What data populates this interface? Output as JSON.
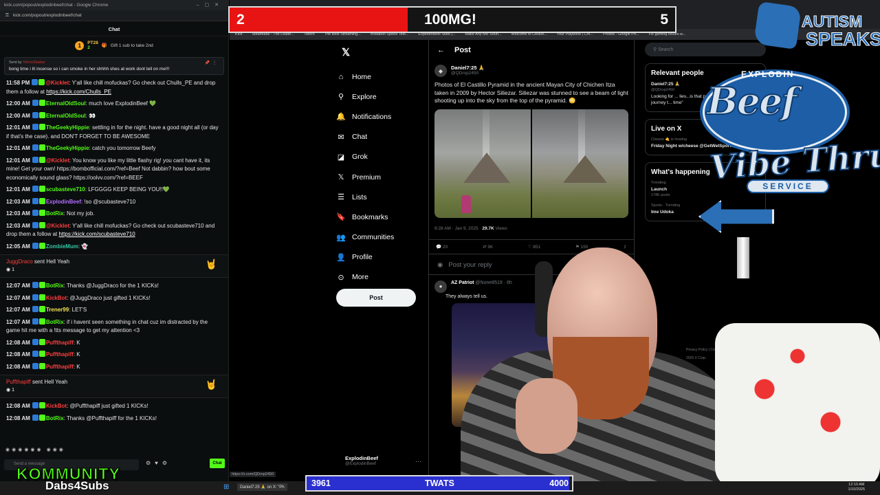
{
  "chat_window": {
    "title": "kick.com/popout/explodinbeef/chat - Google Chrome",
    "url": "kick.com/popout/explodinbeef/chat",
    "header": "Chat",
    "gift_bar": {
      "rank": "1",
      "user": "PT28",
      "count": "2",
      "label": "Gift 1 sub to take 2nd"
    },
    "pinned": {
      "sent_by": "Sent by",
      "pinner": "TehnoSkabar",
      "message": "bong time i lit incense so i can smoke in her shhhh shes at work dont tell on me!!!"
    },
    "messages": [
      {
        "ts": "11:58 PM",
        "user": "@Kicklet",
        "cls": "u-red",
        "text": ": Y'all like chill mofuckas? Go check out Chulls_PE and drop them a follow at ",
        "link": "https://kick.com/Chulls_PE"
      },
      {
        "ts": "12:00 AM",
        "user": "EternalOldSoul",
        "cls": "u-green",
        "text": ": much love ExplodinBeef 💚",
        "link": ""
      },
      {
        "ts": "12:00 AM",
        "user": "EternalOldSoul",
        "cls": "u-green",
        "text": ": 👀",
        "link": ""
      },
      {
        "ts": "12:01 AM",
        "user": "TheGeekyHippie",
        "cls": "u-green",
        "text": ": settling in for the night. have a good night all (or day if that's the case). and DON'T FORGET TO BE AWESOME",
        "link": ""
      },
      {
        "ts": "12:01 AM",
        "user": "TheGeekyHippie",
        "cls": "u-green",
        "text": ": catch you tomorrow Beefy",
        "link": ""
      },
      {
        "ts": "12:01 AM",
        "user": "@Kicklet",
        "cls": "u-red",
        "text": ": You know you like my little flashy rig! you cant have it, its mine! Get your own! https://bombofficial.com/?ref=Beef Not dabbin? how bout some economically sound glass? https://oolvv.com/?ref=BEEF",
        "link": ""
      },
      {
        "ts": "12:01 AM",
        "user": "scubasteve710",
        "cls": "u-green",
        "text": ": LFGGGG KEEP BEING YOU!!💚",
        "link": ""
      },
      {
        "ts": "12:03 AM",
        "user": "ExplodinBeef",
        "cls": "u-purple",
        "text": ": !so @scubasteve710",
        "link": ""
      },
      {
        "ts": "12:03 AM",
        "user": "BotRix",
        "cls": "u-green",
        "text": ": Not my job.",
        "link": ""
      },
      {
        "ts": "12:03 AM",
        "user": "@Kicklet",
        "cls": "u-red",
        "text": ": Y'all like chill mofuckas? Go check out scubasteve710 and drop them a follow at ",
        "link": "https://kick.com/scubasteve710"
      },
      {
        "ts": "12:05 AM",
        "user": "ZombieMum",
        "cls": "u-teal",
        "text": ": 👻",
        "link": ""
      }
    ],
    "gift1": {
      "user": "JuggDraco",
      "action": "sent Hell Yeah",
      "kicks": "1"
    },
    "messages2": [
      {
        "ts": "12:07 AM",
        "user": "BotRix",
        "cls": "u-green",
        "text": ": Thanks @JuggDraco for the 1 KICKs!"
      },
      {
        "ts": "12:07 AM",
        "user": "KickBot",
        "cls": "u-red",
        "text": ": @JuggDraco just gifted 1 KICKs!"
      },
      {
        "ts": "12:07 AM",
        "user": "Trener99",
        "cls": "u-yel",
        "text": ": LET'S"
      },
      {
        "ts": "12:07 AM",
        "user": "BotRix",
        "cls": "u-green",
        "text": ": if i havent seen something in chat cuz im distracted by the game hit me with a !tts message to get my attention <3"
      },
      {
        "ts": "12:08 AM",
        "user": "Puffthapiff",
        "cls": "u-red",
        "text": ": K"
      },
      {
        "ts": "12:08 AM",
        "user": "Puffthapiff",
        "cls": "u-red",
        "text": ": K"
      },
      {
        "ts": "12:08 AM",
        "user": "Puffthapiff",
        "cls": "u-red",
        "text": ": K"
      }
    ],
    "gift2": {
      "user": "Puffthapiff",
      "action": "sent Hell Yeah",
      "kicks": "1"
    },
    "messages3": [
      {
        "ts": "12:08 AM",
        "user": "KickBot",
        "cls": "u-red",
        "text": ": @Puffthapiff just gifted 1 KICKs!"
      },
      {
        "ts": "12:08 AM",
        "user": "BotRix",
        "cls": "u-green",
        "text": ": Thanks @Puffthapiff for the 1 KICKs!"
      }
    ],
    "input_placeholder": "Send a message",
    "send_label": "Chat",
    "kommunity": "KOMMUNITY",
    "dabs": "Dabs4Subs"
  },
  "x": {
    "bookmarks": [
      "Kick",
      "Steamlabs - The Leade...",
      "Twitch",
      "The Best Streaming...",
      "Invitation Speed Test...",
      "ExplodinBeef Stats |...",
      "Make Any Mic Soun...",
      "Welcome to Cleavo...",
      "Your Playbook | Cre...",
      "Photos - Google Ph...",
      "Fix gaming issues w..."
    ],
    "nav": [
      {
        "icon": "home-icon",
        "glyph": "⌂",
        "label": "Home"
      },
      {
        "icon": "search-icon",
        "glyph": "⚲",
        "label": "Explore"
      },
      {
        "icon": "bell-icon",
        "glyph": "🔔",
        "label": "Notifications"
      },
      {
        "icon": "mail-icon",
        "glyph": "✉",
        "label": "Chat"
      },
      {
        "icon": "grok-icon",
        "glyph": "◪",
        "label": "Grok"
      },
      {
        "icon": "x-logo-icon",
        "glyph": "𝕏",
        "label": "Premium"
      },
      {
        "icon": "list-icon",
        "glyph": "☰",
        "label": "Lists"
      },
      {
        "icon": "bookmark-icon",
        "glyph": "🔖",
        "label": "Bookmarks"
      },
      {
        "icon": "people-icon",
        "glyph": "👥",
        "label": "Communities"
      },
      {
        "icon": "person-icon",
        "glyph": "👤",
        "label": "Profile"
      },
      {
        "icon": "more-icon",
        "glyph": "⊙",
        "label": "More"
      }
    ],
    "post_button": "Post",
    "account": {
      "name": "ExplodinBeef",
      "handle": "@ExplodinBeef"
    },
    "post": {
      "header": "Post",
      "author": "Daniel7:25 🙏",
      "handle": "@QDrop2450",
      "text": "Photos of El Castillo Pyramid in the ancient Mayan City of Chichen Itza taken in 2009 by Hector Siliezar. Siliezar was stunned to see a beam of light shooting up into the sky from the top of the pyramid. 😳",
      "time": "9:28 AM · Jan 9, 2025 · ",
      "views": "29.7K",
      "views_label": " Views",
      "replies": "20",
      "reposts": "96",
      "likes": "851",
      "bookmarks": "150"
    },
    "reply_placeholder": "Post your reply",
    "reply": {
      "name": "AZ Patriot",
      "handle": "@None8519 · 6h",
      "text": "They always tell us."
    },
    "search_placeholder": "Search",
    "relevant": {
      "title": "Relevant people",
      "name": "Daniel7:25 🙏",
      "handle": "@QDrop2450",
      "bio": "Looking for ... lies...is that p... brave new wo... this journey t... time\""
    },
    "live": {
      "title": "Live on X",
      "host": "Cheese 🤙 is hosting",
      "text": "Friday Night w/cheese @GetWetSports —"
    },
    "happening": {
      "title": "What's happening",
      "t1_meta": "Trending",
      "t1": "Launch",
      "t1_posts": "178K posts",
      "t2_meta": "Sports · Trending",
      "t2": "Ime Udoka"
    },
    "footer": "Privacy Policy | Cookie Policy | Ads info | More ··· © 2025 X Corp."
  },
  "overlays": {
    "top_left": "2",
    "top_center": "100MG!",
    "top_right": "5",
    "top_progress": 0.4,
    "bottom_left": "3961",
    "bottom_center": "TWATS",
    "bottom_right": "4000",
    "bottom_progress": 0.99,
    "autism1": "AUTISM",
    "autism2": "SPEAKS",
    "beef_small": "EXPLODIN",
    "beef_big": "Beef",
    "vibe": "Vibe Thru",
    "service": "SERVICE",
    "clock_time": "12:10 AM",
    "clock_date": "1/10/2025",
    "taskbar_item": "Daniel7:25 🙏 on X: \"Ph",
    "status_url": "https://x.com/QDrop2450",
    "browser_label": "Gemini"
  },
  "colors": {
    "kick_green": "#53fc18",
    "x_bg": "#000000",
    "top_bar_red": "#e81414",
    "bottom_bar_blue": "#2a2fcf",
    "autism_blue": "#2b6fb6"
  }
}
